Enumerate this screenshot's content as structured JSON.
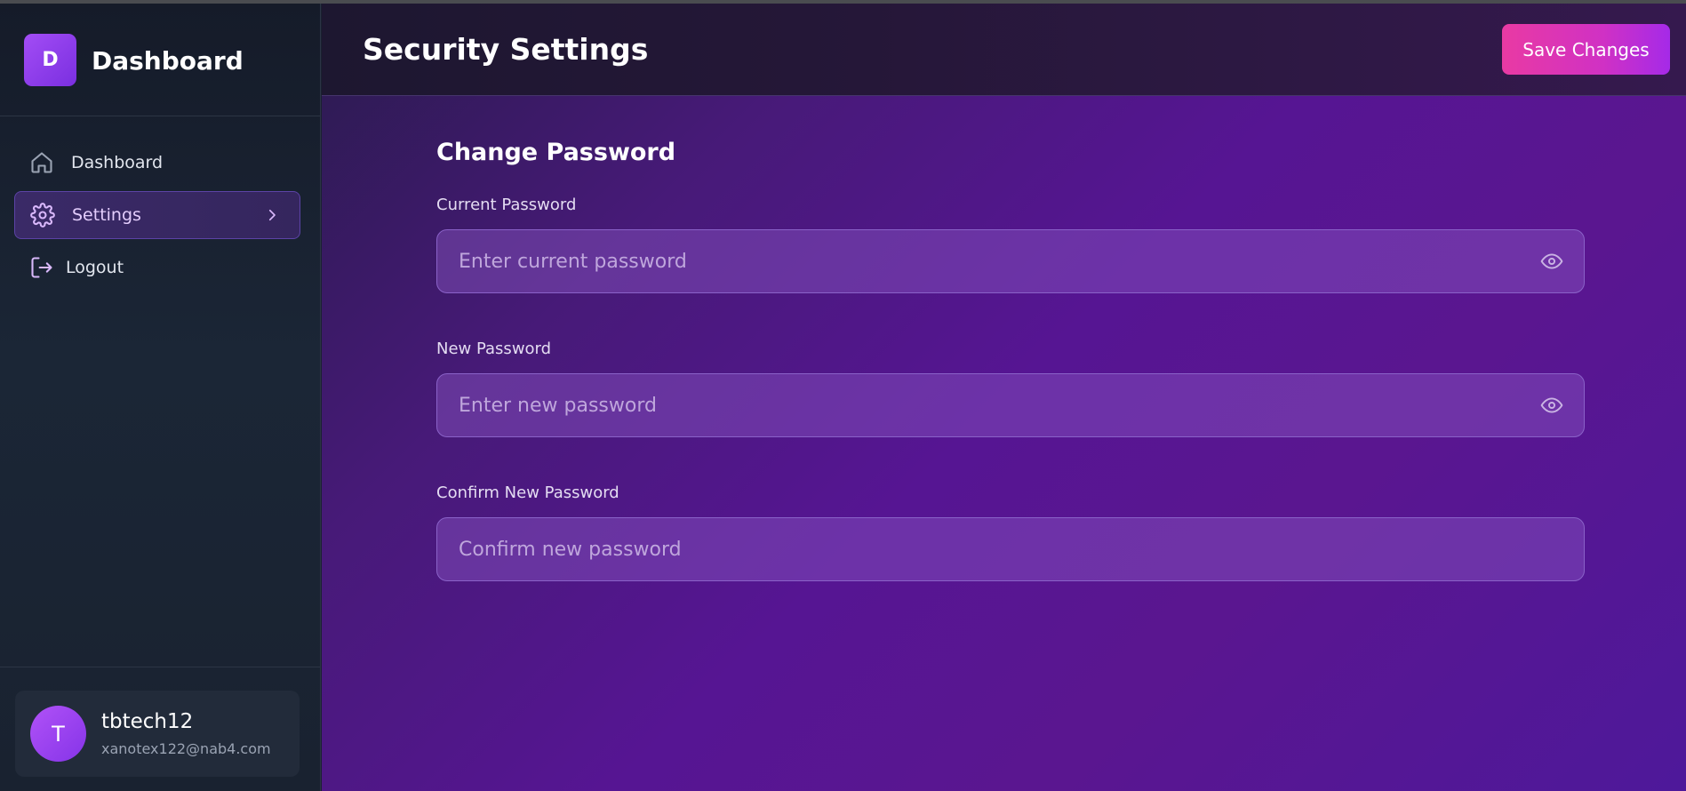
{
  "sidebar": {
    "brand": {
      "logo_letter": "D",
      "title": "Dashboard"
    },
    "items": [
      {
        "label": "Dashboard",
        "icon": "home-icon"
      },
      {
        "label": "Settings",
        "icon": "gear-icon",
        "active": true
      },
      {
        "label": "Logout",
        "icon": "logout-icon"
      }
    ],
    "user": {
      "initial": "T",
      "name": "tbtech12",
      "email": "xanotex122@nab4.com"
    }
  },
  "header": {
    "title": "Security Settings",
    "save_label": "Save Changes"
  },
  "form": {
    "section_title": "Change Password",
    "current": {
      "label": "Current Password",
      "placeholder": "Enter current password"
    },
    "new": {
      "label": "New Password",
      "placeholder": "Enter new password"
    },
    "confirm": {
      "label": "Confirm New Password",
      "placeholder": "Confirm new password"
    }
  },
  "colors": {
    "accent": "#9b3ff0",
    "save_button": "#e93aa3",
    "active_nav": "#3a2a67"
  }
}
